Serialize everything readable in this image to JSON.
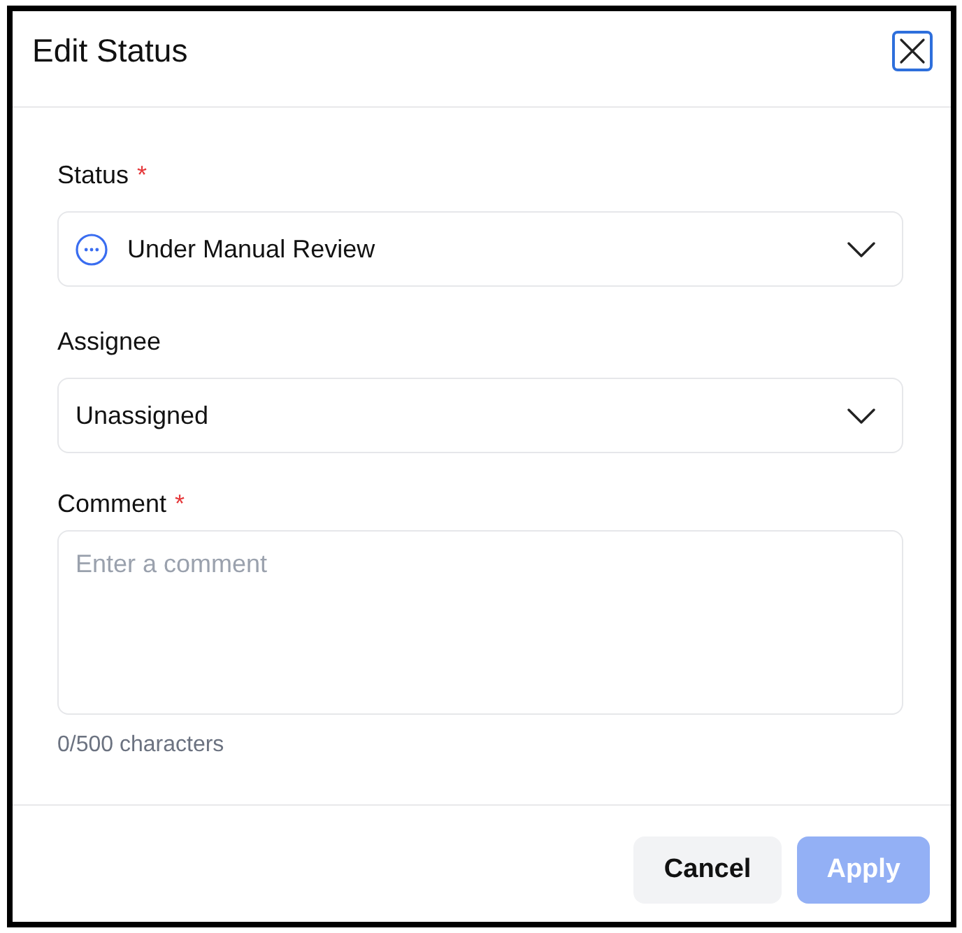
{
  "dialog": {
    "title": "Edit Status",
    "close_button": {
      "focused": true
    }
  },
  "fields": [
    {
      "kind": "status_select",
      "label": "Status",
      "required_mark": "*",
      "value": "Under Manual Review"
    },
    {
      "kind": "select",
      "label": "Assignee",
      "value": "Unassigned"
    },
    {
      "kind": "textarea",
      "label": "Comment",
      "required_mark": "*",
      "placeholder": "Enter a comment",
      "counter": "0/500 characters"
    }
  ],
  "buttons": [
    {
      "label": "Cancel",
      "kind": "secondary",
      "disabled": false
    },
    {
      "label": "Apply",
      "kind": "primary",
      "disabled": true
    }
  ]
}
